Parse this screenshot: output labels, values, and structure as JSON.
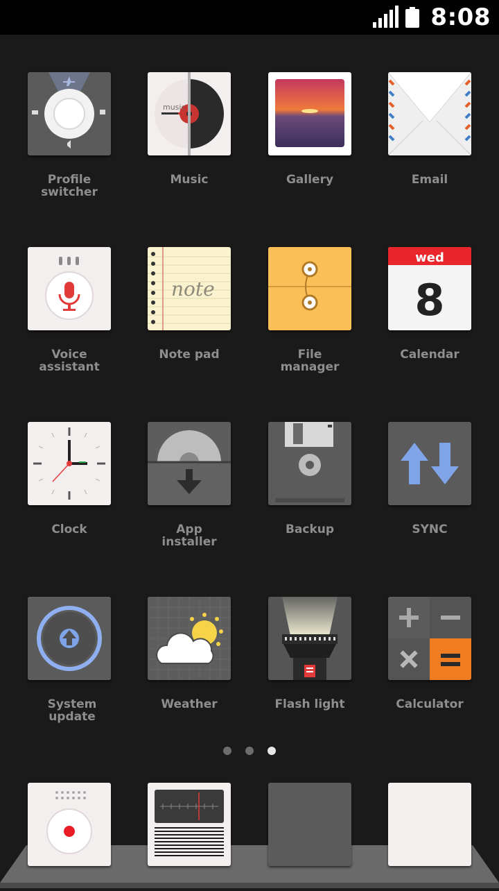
{
  "status_bar": {
    "time": "8:08",
    "signal_icon": "signal-icon",
    "battery_icon": "battery-icon"
  },
  "apps": [
    {
      "label": "Profile\nswitcher",
      "icon": "profile-switcher-icon"
    },
    {
      "label": "Music",
      "icon": "music-icon",
      "text": "music"
    },
    {
      "label": "Gallery",
      "icon": "gallery-icon"
    },
    {
      "label": "Email",
      "icon": "email-icon"
    },
    {
      "label": "Voice\nassistant",
      "icon": "microphone-icon"
    },
    {
      "label": "Note pad",
      "icon": "notepad-icon",
      "text": "note"
    },
    {
      "label": "File\nmanager",
      "icon": "file-manager-icon"
    },
    {
      "label": "Calendar",
      "icon": "calendar-icon",
      "day": "wed",
      "date": "8"
    },
    {
      "label": "Clock",
      "icon": "clock-icon"
    },
    {
      "label": "App\ninstaller",
      "icon": "app-installer-icon"
    },
    {
      "label": "Backup",
      "icon": "floppy-disk-icon"
    },
    {
      "label": "SYNC",
      "icon": "sync-icon"
    },
    {
      "label": "System\nupdate",
      "icon": "system-update-icon"
    },
    {
      "label": "Weather",
      "icon": "weather-icon"
    },
    {
      "label": "Flash light",
      "icon": "flashlight-icon"
    },
    {
      "label": "Calculator",
      "icon": "calculator-icon"
    }
  ],
  "page_indicator": {
    "count": 3,
    "active_index": 2
  },
  "dock": [
    {
      "icon": "recorder-icon"
    },
    {
      "icon": "radio-icon"
    },
    {
      "icon": "blank-dark-icon"
    },
    {
      "icon": "blank-light-icon"
    }
  ]
}
